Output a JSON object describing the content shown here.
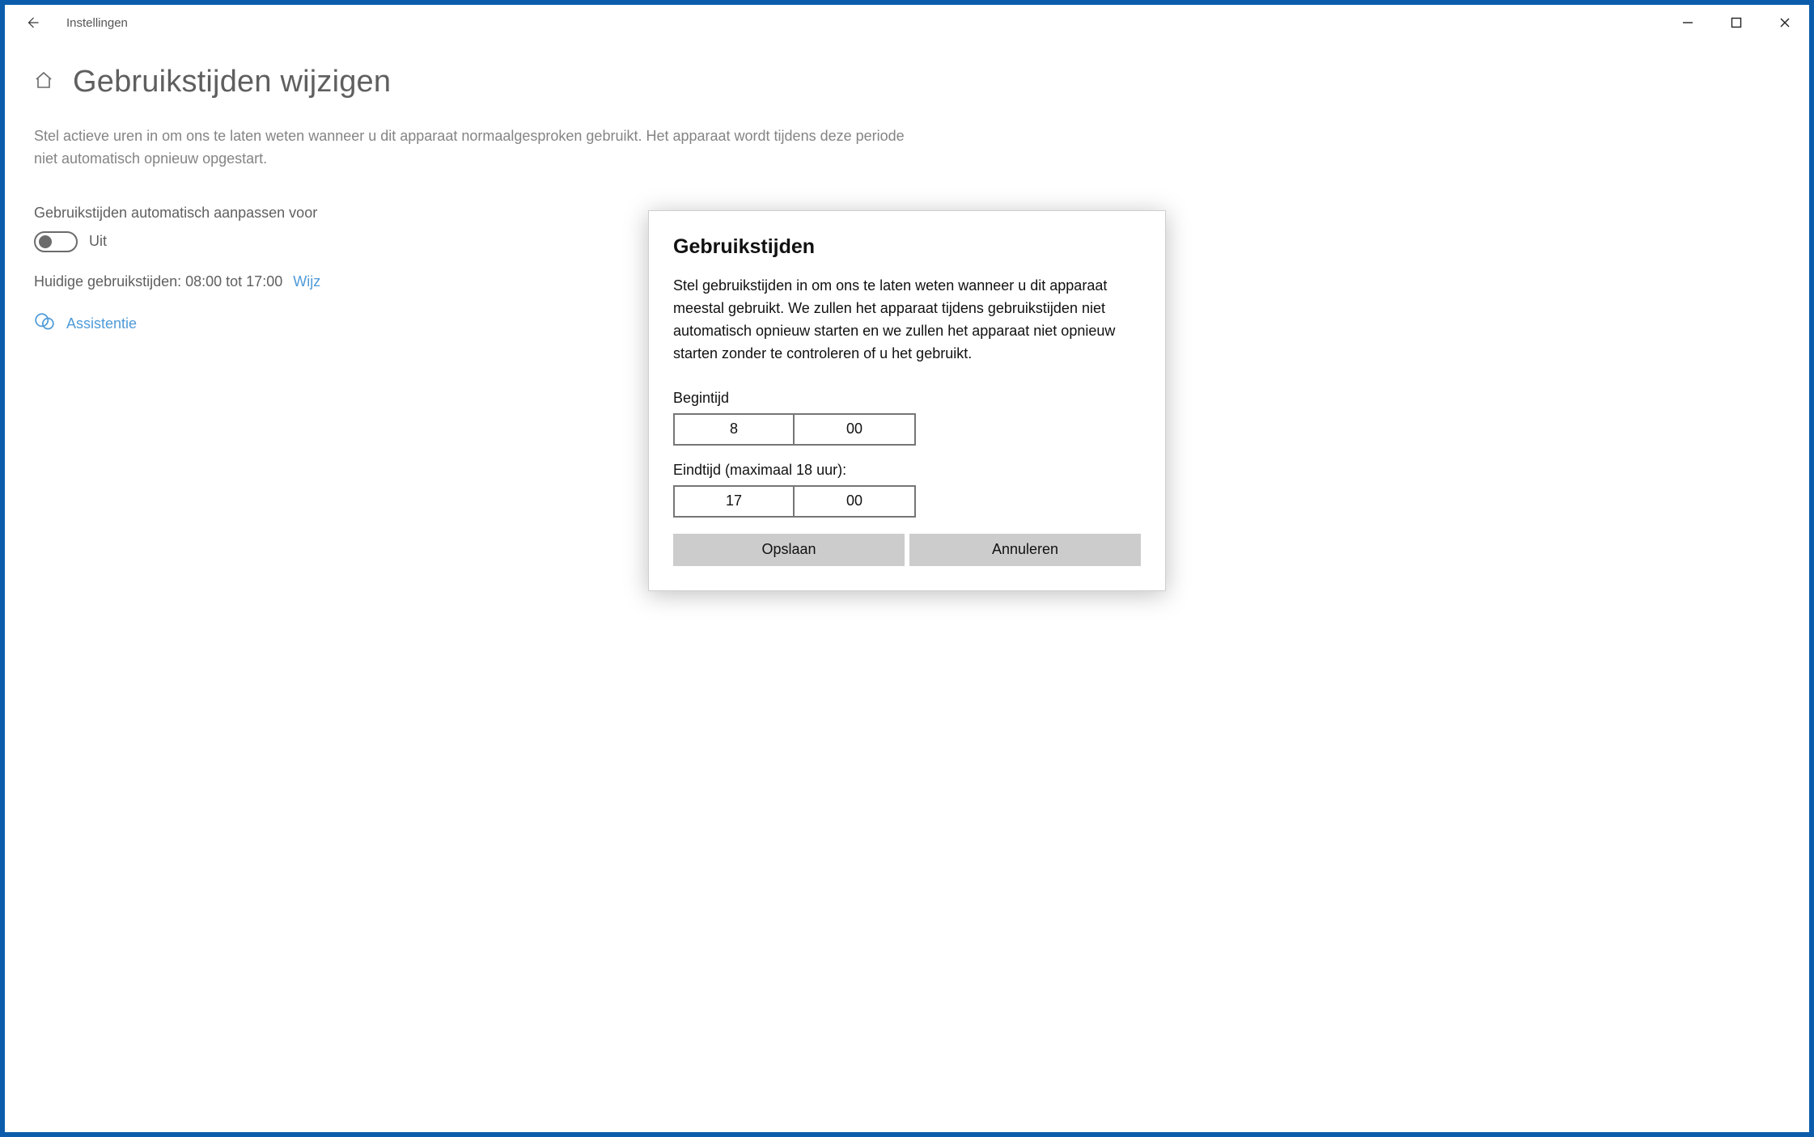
{
  "window": {
    "app_title": "Instellingen"
  },
  "page": {
    "title": "Gebruikstijden wijzigen",
    "description": "Stel actieve uren in om ons te laten weten wanneer u dit apparaat normaalgesproken gebruikt. Het apparaat wordt tijdens deze periode niet automatisch opnieuw opgestart.",
    "auto_adjust_label": "Gebruikstijden automatisch aanpassen voor",
    "toggle_state": "Uit",
    "current_hours_text": "Huidige gebruikstijden: 08:00 tot 17:00",
    "change_link": "Wijz",
    "help_link": "Assistentie"
  },
  "modal": {
    "title": "Gebruikstijden",
    "description": "Stel gebruikstijden in om ons te laten weten wanneer u dit apparaat meestal gebruikt. We zullen het apparaat tijdens gebruikstijden niet automatisch opnieuw starten en we zullen het apparaat niet opnieuw starten zonder te controleren of u het gebruikt.",
    "start_label": "Begintijd",
    "start_hour": "8",
    "start_minute": "00",
    "end_label": "Eindtijd (maximaal 18 uur):",
    "end_hour": "17",
    "end_minute": "00",
    "save_label": "Opslaan",
    "cancel_label": "Annuleren"
  }
}
